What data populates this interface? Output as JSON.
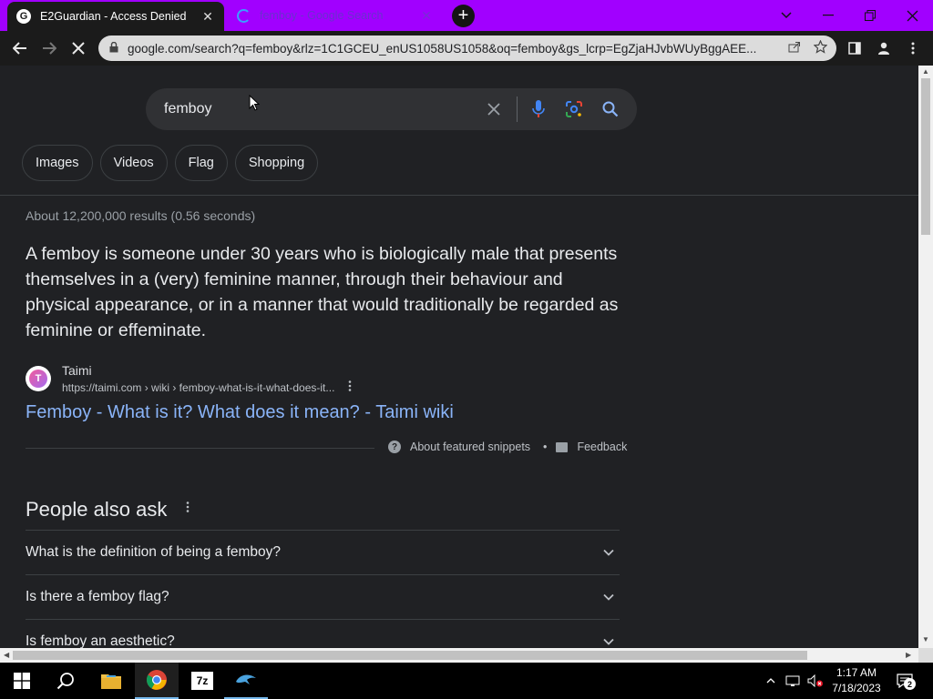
{
  "tabs": [
    {
      "title": "E2Guardian - Access Denied",
      "favicon": "google-g",
      "active": true
    },
    {
      "title": "femboy - Google Search",
      "favicon": "loading-spinner",
      "active": false
    }
  ],
  "window_controls": [
    "chevron-down",
    "minimize",
    "restore",
    "close"
  ],
  "address_bar": {
    "url": "google.com/search?q=femboy&rlz=1C1GCEU_enUS1058US1058&oq=femboy&gs_lcrp=EgZjaHJvbWUyBggAEE..."
  },
  "search": {
    "query": "femboy"
  },
  "filters": [
    "Images",
    "Videos",
    "Flag",
    "Shopping"
  ],
  "results_stats": "About 12,200,000 results (0.56 seconds)",
  "featured_snippet": {
    "text": "A femboy is someone under 30 years who is biologically male that presents themselves in a (very) feminine manner, through their behaviour and physical appearance, or in a manner that would traditionally be regarded as feminine or effeminate.",
    "source_logo_letter": "T",
    "source_name": "Taimi",
    "source_url": "https://taimi.com › wiki › femboy-what-is-it-what-does-it...",
    "link_title": "Femboy - What is it? What does it mean? - Taimi wiki",
    "about_label": "About featured snippets",
    "separator": "•",
    "feedback_label": "Feedback"
  },
  "people_also_ask": {
    "title": "People also ask",
    "questions": [
      "What is the definition of being a femboy?",
      "Is there a femboy flag?",
      "Is femboy an aesthetic?"
    ]
  },
  "taskbar": {
    "apps": [
      "windows-start",
      "search",
      "file-explorer",
      "chrome",
      "7-zip",
      "dolphin-emulator"
    ],
    "seven_zip_label": "7z",
    "time": "1:17 AM",
    "date": "7/18/2023",
    "notification_count": "2"
  },
  "colors": {
    "tabstrip": "#a100ff",
    "page_bg": "#202124",
    "link": "#8ab4f8",
    "mic_blue": "#4285f4",
    "mic_red": "#ea4335",
    "search_icon": "#8ab4f8"
  }
}
